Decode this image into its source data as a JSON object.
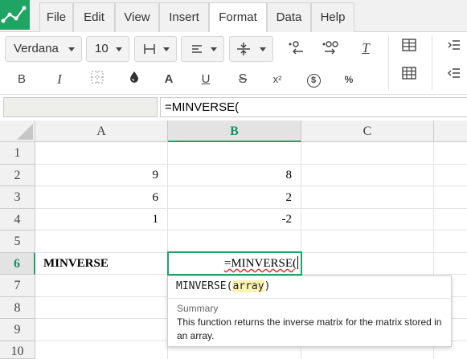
{
  "menu": {
    "items": [
      {
        "label": "File"
      },
      {
        "label": "Edit"
      },
      {
        "label": "View"
      },
      {
        "label": "Insert"
      },
      {
        "label": "Format"
      },
      {
        "label": "Data"
      },
      {
        "label": "Help"
      }
    ],
    "active": "Format"
  },
  "toolbar": {
    "font_family": "Verdana",
    "font_size": "10",
    "bold_glyph": "B",
    "italic_glyph": "I",
    "text_color_glyph": "A",
    "underline_glyph": "U",
    "strike_glyph": "S",
    "superscript_glyph": "x²",
    "currency_glyph": "$",
    "percent_glyph": "%",
    "clear_format_glyph": "T"
  },
  "formula_bar": {
    "name_box": "",
    "formula": "=MINVERSE("
  },
  "grid": {
    "columns": [
      "A",
      "B",
      "C"
    ],
    "rows": [
      "1",
      "2",
      "3",
      "4",
      "5",
      "6",
      "7",
      "8",
      "9",
      "10"
    ],
    "cells": {
      "A2": "9",
      "B2": "8",
      "A3": "6",
      "B3": "2",
      "A4": "1",
      "B4": "-2",
      "A6": "MINVERSE",
      "B6": "=MINVERSE("
    },
    "active_cell": "B6"
  },
  "tooltip": {
    "func_name": "MINVERSE",
    "open_paren": "(",
    "arg": "array",
    "close_paren": ")",
    "summary_title": "Summary",
    "summary_text": "This function returns the inverse matrix for the matrix stored in an array."
  },
  "colors": {
    "accent": "#21a366",
    "logo": "#1fa463"
  }
}
